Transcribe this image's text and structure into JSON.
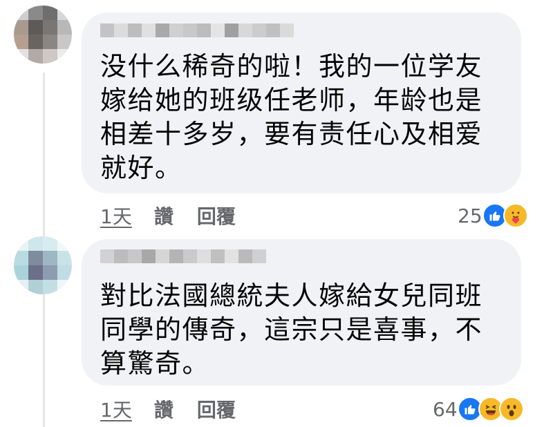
{
  "comments": [
    {
      "author_name": "",
      "text": "没什么稀奇的啦！我的一位学友\n嫁给她的班级任老师，年龄也是\n相差十多岁，要有责任心及相爱\n就好。",
      "time": "1天",
      "like_label": "讚",
      "reply_label": "回覆",
      "reaction_count": "25",
      "reactions": [
        "like-icon",
        "care-icon"
      ]
    },
    {
      "author_name": "",
      "text": "對比法國總統夫人嫁給女兒同班\n同學的傳奇，這宗只是喜事，不\n算驚奇。",
      "time": "1天",
      "like_label": "讚",
      "reply_label": "回覆",
      "reaction_count": "64",
      "reactions": [
        "like-icon",
        "haha-icon",
        "wow-icon"
      ]
    }
  ],
  "colors": {
    "bubble": "#f0f2f5",
    "text": "#050505",
    "secondary": "#65676b",
    "like_blue": "#1877f2",
    "emoji_yellow": "#f7b928"
  }
}
